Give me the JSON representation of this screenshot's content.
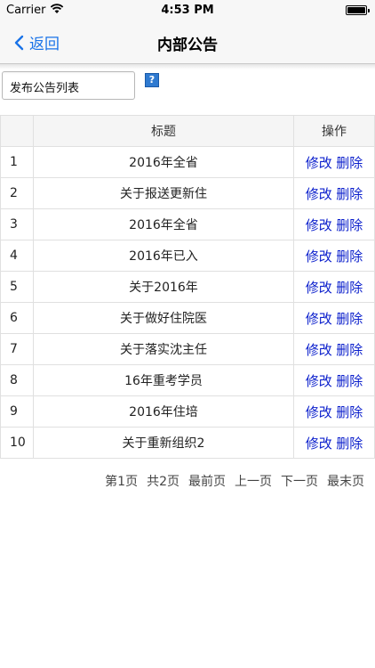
{
  "status_bar": {
    "carrier": "Carrier",
    "time": "4:53 PM"
  },
  "nav": {
    "back_label": "返回",
    "title": "内部公告"
  },
  "toolbar": {
    "publish_label": "发布公告列表",
    "help_glyph": "?"
  },
  "table": {
    "headers": [
      "",
      "标题",
      "操作"
    ],
    "rows": [
      {
        "idx": "1",
        "title": "2016年全省",
        "edit": "修改",
        "delete": "删除"
      },
      {
        "idx": "2",
        "title": "关于报送更新住",
        "edit": "修改",
        "delete": "删除"
      },
      {
        "idx": "3",
        "title": "2016年全省",
        "edit": "修改",
        "delete": "删除"
      },
      {
        "idx": "4",
        "title": "2016年已入",
        "edit": "修改",
        "delete": "删除"
      },
      {
        "idx": "5",
        "title": "关于2016年",
        "edit": "修改",
        "delete": "删除"
      },
      {
        "idx": "6",
        "title": "关于做好住院医",
        "edit": "修改",
        "delete": "删除"
      },
      {
        "idx": "7",
        "title": "关于落实沈主任",
        "edit": "修改",
        "delete": "删除"
      },
      {
        "idx": "8",
        "title": "16年重考学员",
        "edit": "修改",
        "delete": "删除"
      },
      {
        "idx": "9",
        "title": "2016年住培",
        "edit": "修改",
        "delete": "删除"
      },
      {
        "idx": "10",
        "title": "关于重新组织2",
        "edit": "修改",
        "delete": "删除"
      }
    ]
  },
  "pagination": {
    "current": "第1页",
    "total": "共2页",
    "first": "最前页",
    "prev": "上一页",
    "next": "下一页",
    "last": "最末页"
  },
  "colors": {
    "link": "#0b1fcc",
    "nav_back": "#1a73e8"
  }
}
